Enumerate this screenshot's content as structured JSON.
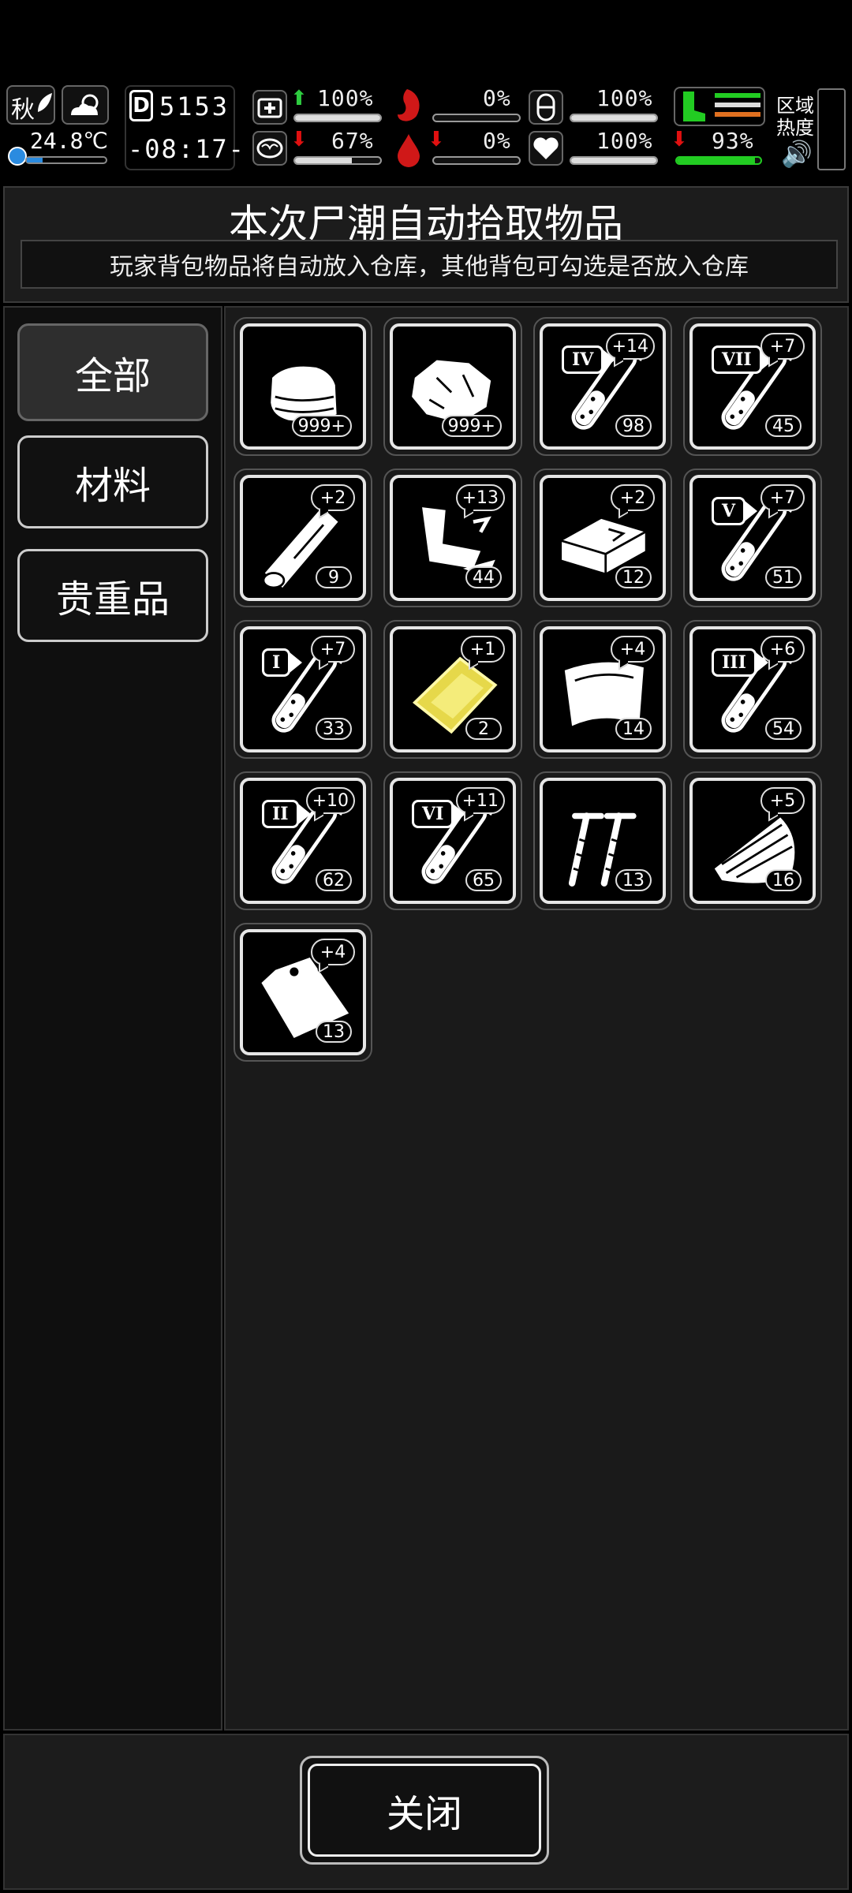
{
  "status_bar": {
    "season": "秋",
    "temperature": "24.8℃",
    "day": "5153",
    "day_prefix": "D",
    "time": "-08:17-",
    "health_pct": "100%",
    "hunger_pct": "0%",
    "stamina_pct": "100%",
    "sanity_pct": "67%",
    "bleed_pct": "0%",
    "mood_pct": "100%",
    "legs_pct": "93%",
    "zone_heat_label": "区域热度",
    "colors": {
      "up": "#2ecc40",
      "down": "#e01010",
      "legs": "#22cc22",
      "heat_orange": "#e07020"
    }
  },
  "header": {
    "title": "本次尸潮自动拾取物品",
    "subtitle": "玩家背包物品将自动放入仓库，其他背包可勾选是否放入仓库"
  },
  "tabs": [
    {
      "label": "全部",
      "active": true
    },
    {
      "label": "材料",
      "active": false
    },
    {
      "label": "贵重品",
      "active": false
    }
  ],
  "items": [
    {
      "icon": "cloth-icon",
      "count": "999+",
      "plus": "",
      "roman": ""
    },
    {
      "icon": "stone-icon",
      "count": "999+",
      "plus": "",
      "roman": ""
    },
    {
      "icon": "test-tube-icon",
      "count": "98",
      "plus": "+14",
      "roman": "IV"
    },
    {
      "icon": "test-tube-icon",
      "count": "45",
      "plus": "+7",
      "roman": "VII"
    },
    {
      "icon": "wood-log-icon",
      "count": "9",
      "plus": "+2",
      "roman": ""
    },
    {
      "icon": "scrap-metal-icon",
      "count": "44",
      "plus": "+13",
      "roman": ""
    },
    {
      "icon": "metal-ingot-icon",
      "count": "12",
      "plus": "+2",
      "roman": ""
    },
    {
      "icon": "test-tube-icon",
      "count": "51",
      "plus": "+7",
      "roman": "V"
    },
    {
      "icon": "test-tube-icon",
      "count": "33",
      "plus": "+7",
      "roman": "I"
    },
    {
      "icon": "gold-plate-icon",
      "count": "2",
      "plus": "+1",
      "roman": ""
    },
    {
      "icon": "leather-icon",
      "count": "14",
      "plus": "+4",
      "roman": ""
    },
    {
      "icon": "test-tube-icon",
      "count": "54",
      "plus": "+6",
      "roman": "III"
    },
    {
      "icon": "test-tube-icon",
      "count": "62",
      "plus": "+10",
      "roman": "II"
    },
    {
      "icon": "test-tube-icon",
      "count": "65",
      "plus": "+11",
      "roman": "VI"
    },
    {
      "icon": "nails-icon",
      "count": "13",
      "plus": "",
      "roman": ""
    },
    {
      "icon": "wood-planks-icon",
      "count": "16",
      "plus": "+5",
      "roman": ""
    },
    {
      "icon": "plastic-bag-icon",
      "count": "13",
      "plus": "+4",
      "roman": ""
    }
  ],
  "footer": {
    "close_label": "关闭"
  }
}
